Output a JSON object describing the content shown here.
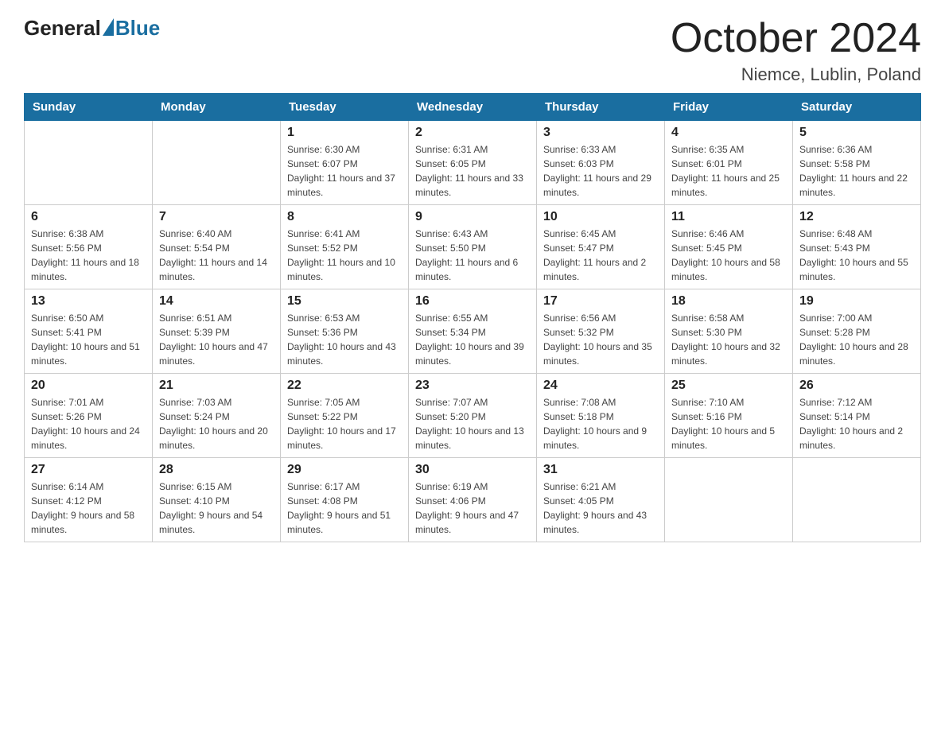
{
  "header": {
    "logo_general": "General",
    "logo_blue": "Blue",
    "month_title": "October 2024",
    "location": "Niemce, Lublin, Poland"
  },
  "weekdays": [
    "Sunday",
    "Monday",
    "Tuesday",
    "Wednesday",
    "Thursday",
    "Friday",
    "Saturday"
  ],
  "weeks": [
    [
      {
        "day": "",
        "sunrise": "",
        "sunset": "",
        "daylight": ""
      },
      {
        "day": "",
        "sunrise": "",
        "sunset": "",
        "daylight": ""
      },
      {
        "day": "1",
        "sunrise": "Sunrise: 6:30 AM",
        "sunset": "Sunset: 6:07 PM",
        "daylight": "Daylight: 11 hours and 37 minutes."
      },
      {
        "day": "2",
        "sunrise": "Sunrise: 6:31 AM",
        "sunset": "Sunset: 6:05 PM",
        "daylight": "Daylight: 11 hours and 33 minutes."
      },
      {
        "day": "3",
        "sunrise": "Sunrise: 6:33 AM",
        "sunset": "Sunset: 6:03 PM",
        "daylight": "Daylight: 11 hours and 29 minutes."
      },
      {
        "day": "4",
        "sunrise": "Sunrise: 6:35 AM",
        "sunset": "Sunset: 6:01 PM",
        "daylight": "Daylight: 11 hours and 25 minutes."
      },
      {
        "day": "5",
        "sunrise": "Sunrise: 6:36 AM",
        "sunset": "Sunset: 5:58 PM",
        "daylight": "Daylight: 11 hours and 22 minutes."
      }
    ],
    [
      {
        "day": "6",
        "sunrise": "Sunrise: 6:38 AM",
        "sunset": "Sunset: 5:56 PM",
        "daylight": "Daylight: 11 hours and 18 minutes."
      },
      {
        "day": "7",
        "sunrise": "Sunrise: 6:40 AM",
        "sunset": "Sunset: 5:54 PM",
        "daylight": "Daylight: 11 hours and 14 minutes."
      },
      {
        "day": "8",
        "sunrise": "Sunrise: 6:41 AM",
        "sunset": "Sunset: 5:52 PM",
        "daylight": "Daylight: 11 hours and 10 minutes."
      },
      {
        "day": "9",
        "sunrise": "Sunrise: 6:43 AM",
        "sunset": "Sunset: 5:50 PM",
        "daylight": "Daylight: 11 hours and 6 minutes."
      },
      {
        "day": "10",
        "sunrise": "Sunrise: 6:45 AM",
        "sunset": "Sunset: 5:47 PM",
        "daylight": "Daylight: 11 hours and 2 minutes."
      },
      {
        "day": "11",
        "sunrise": "Sunrise: 6:46 AM",
        "sunset": "Sunset: 5:45 PM",
        "daylight": "Daylight: 10 hours and 58 minutes."
      },
      {
        "day": "12",
        "sunrise": "Sunrise: 6:48 AM",
        "sunset": "Sunset: 5:43 PM",
        "daylight": "Daylight: 10 hours and 55 minutes."
      }
    ],
    [
      {
        "day": "13",
        "sunrise": "Sunrise: 6:50 AM",
        "sunset": "Sunset: 5:41 PM",
        "daylight": "Daylight: 10 hours and 51 minutes."
      },
      {
        "day": "14",
        "sunrise": "Sunrise: 6:51 AM",
        "sunset": "Sunset: 5:39 PM",
        "daylight": "Daylight: 10 hours and 47 minutes."
      },
      {
        "day": "15",
        "sunrise": "Sunrise: 6:53 AM",
        "sunset": "Sunset: 5:36 PM",
        "daylight": "Daylight: 10 hours and 43 minutes."
      },
      {
        "day": "16",
        "sunrise": "Sunrise: 6:55 AM",
        "sunset": "Sunset: 5:34 PM",
        "daylight": "Daylight: 10 hours and 39 minutes."
      },
      {
        "day": "17",
        "sunrise": "Sunrise: 6:56 AM",
        "sunset": "Sunset: 5:32 PM",
        "daylight": "Daylight: 10 hours and 35 minutes."
      },
      {
        "day": "18",
        "sunrise": "Sunrise: 6:58 AM",
        "sunset": "Sunset: 5:30 PM",
        "daylight": "Daylight: 10 hours and 32 minutes."
      },
      {
        "day": "19",
        "sunrise": "Sunrise: 7:00 AM",
        "sunset": "Sunset: 5:28 PM",
        "daylight": "Daylight: 10 hours and 28 minutes."
      }
    ],
    [
      {
        "day": "20",
        "sunrise": "Sunrise: 7:01 AM",
        "sunset": "Sunset: 5:26 PM",
        "daylight": "Daylight: 10 hours and 24 minutes."
      },
      {
        "day": "21",
        "sunrise": "Sunrise: 7:03 AM",
        "sunset": "Sunset: 5:24 PM",
        "daylight": "Daylight: 10 hours and 20 minutes."
      },
      {
        "day": "22",
        "sunrise": "Sunrise: 7:05 AM",
        "sunset": "Sunset: 5:22 PM",
        "daylight": "Daylight: 10 hours and 17 minutes."
      },
      {
        "day": "23",
        "sunrise": "Sunrise: 7:07 AM",
        "sunset": "Sunset: 5:20 PM",
        "daylight": "Daylight: 10 hours and 13 minutes."
      },
      {
        "day": "24",
        "sunrise": "Sunrise: 7:08 AM",
        "sunset": "Sunset: 5:18 PM",
        "daylight": "Daylight: 10 hours and 9 minutes."
      },
      {
        "day": "25",
        "sunrise": "Sunrise: 7:10 AM",
        "sunset": "Sunset: 5:16 PM",
        "daylight": "Daylight: 10 hours and 5 minutes."
      },
      {
        "day": "26",
        "sunrise": "Sunrise: 7:12 AM",
        "sunset": "Sunset: 5:14 PM",
        "daylight": "Daylight: 10 hours and 2 minutes."
      }
    ],
    [
      {
        "day": "27",
        "sunrise": "Sunrise: 6:14 AM",
        "sunset": "Sunset: 4:12 PM",
        "daylight": "Daylight: 9 hours and 58 minutes."
      },
      {
        "day": "28",
        "sunrise": "Sunrise: 6:15 AM",
        "sunset": "Sunset: 4:10 PM",
        "daylight": "Daylight: 9 hours and 54 minutes."
      },
      {
        "day": "29",
        "sunrise": "Sunrise: 6:17 AM",
        "sunset": "Sunset: 4:08 PM",
        "daylight": "Daylight: 9 hours and 51 minutes."
      },
      {
        "day": "30",
        "sunrise": "Sunrise: 6:19 AM",
        "sunset": "Sunset: 4:06 PM",
        "daylight": "Daylight: 9 hours and 47 minutes."
      },
      {
        "day": "31",
        "sunrise": "Sunrise: 6:21 AM",
        "sunset": "Sunset: 4:05 PM",
        "daylight": "Daylight: 9 hours and 43 minutes."
      },
      {
        "day": "",
        "sunrise": "",
        "sunset": "",
        "daylight": ""
      },
      {
        "day": "",
        "sunrise": "",
        "sunset": "",
        "daylight": ""
      }
    ]
  ]
}
